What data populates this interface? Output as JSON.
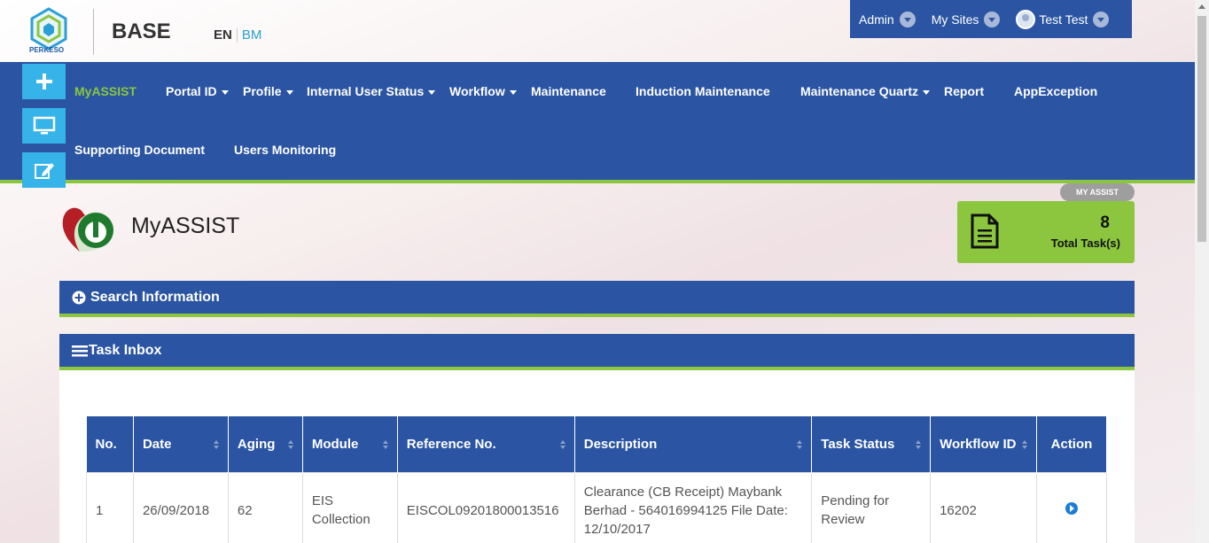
{
  "header": {
    "logo_text": "PERKESO",
    "brand": "BASE",
    "lang_en": "EN",
    "lang_bm": "BM",
    "admin": "Admin",
    "my_sites": "My Sites",
    "user": "Test Test"
  },
  "nav": {
    "items": [
      "MyASSIST",
      "Portal ID",
      "Profile",
      "Internal User Status",
      "Workflow",
      "Maintenance",
      "Induction Maintenance",
      "Maintenance Quartz",
      "Report",
      "AppException",
      "Supporting Document",
      "Users Monitoring"
    ]
  },
  "page": {
    "breadcrumb": "MY ASSIST",
    "title": "MyASSIST",
    "task_count": "8",
    "task_label": "Total Task(s)",
    "search_panel": "Search Information",
    "inbox_panel": "Task Inbox"
  },
  "table": {
    "headers": [
      "No.",
      "Date",
      "Aging",
      "Module",
      "Reference No.",
      "Description",
      "Task Status",
      "Workflow ID",
      "Action"
    ],
    "rows": [
      {
        "no": "1",
        "date": "26/09/2018",
        "aging": "62",
        "module": "EIS Collection",
        "reference": "EISCOL09201800013516",
        "description": "Clearance (CB Receipt) Maybank Berhad - 564016994125 File Date: 12/10/2017",
        "status": "Pending for Review",
        "workflow_id": "16202"
      }
    ]
  },
  "colors": {
    "primary": "#2b55a3",
    "accent_green": "#8cc63f",
    "side_button": "#36b3e8"
  }
}
